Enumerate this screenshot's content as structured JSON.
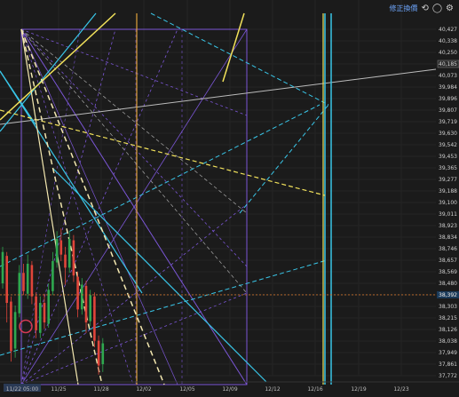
{
  "toolbar": {
    "label": "修正換價",
    "undo_icon": "undo-icon",
    "redo_icon": "redo-icon",
    "settings_icon": "settings-icon"
  },
  "colors": {
    "background": "#1b1b1b",
    "up_candle": "#2fa84f",
    "down_candle": "#e0453a",
    "tool_purple": "#7b56d6",
    "tool_cyan": "#39c6e8",
    "tool_yellow": "#f1e15b",
    "tool_pale_yellow": "#f4e8b0",
    "tool_orange": "#e0a33a",
    "tool_white": "#bbbbbb",
    "current_price_line": "#c7702e",
    "current_price_tag": "#1a3a5a",
    "marker_red": "#d53a55"
  },
  "chart_data": {
    "type": "candlestick",
    "x_axis": {
      "labels": [
        "11/22 05:00",
        "11/25",
        "11/28",
        "12/02",
        "12/05",
        "12/09",
        "12/12",
        "12/16",
        "12/19",
        "12/23"
      ]
    },
    "y_axis": {
      "tick_labels": [
        "40,427",
        "40,338",
        "40,250",
        "40,185",
        "40,073",
        "39,984",
        "39,896",
        "39,807",
        "39,719",
        "39,630",
        "39,542",
        "39,453",
        "39,365",
        "39,277",
        "39,188",
        "39,100",
        "39,011",
        "38,923",
        "38,834",
        "38,746",
        "38,657",
        "38,569",
        "38,480",
        "38,392",
        "38,303",
        "38,215",
        "38,126",
        "38,038",
        "37,949",
        "37,861",
        "37,772"
      ],
      "range": [
        37772,
        40427
      ],
      "highlight_label": "40,185",
      "current_price_label": "38,392"
    },
    "current_price": 38392,
    "candles": [
      {
        "o": 38480,
        "c": 38720,
        "h": 38760,
        "l": 38440
      },
      {
        "o": 38690,
        "c": 38330,
        "h": 38720,
        "l": 38180
      },
      {
        "o": 38340,
        "c": 37960,
        "h": 38380,
        "l": 37880
      },
      {
        "o": 37980,
        "c": 38260,
        "h": 38310,
        "l": 37910
      },
      {
        "o": 38250,
        "c": 38560,
        "h": 38620,
        "l": 38220
      },
      {
        "o": 38560,
        "c": 38420,
        "h": 38630,
        "l": 38390
      },
      {
        "o": 38400,
        "c": 38630,
        "h": 38700,
        "l": 38360
      },
      {
        "o": 38620,
        "c": 38380,
        "h": 38650,
        "l": 38320
      },
      {
        "o": 38380,
        "c": 38120,
        "h": 38410,
        "l": 38060
      },
      {
        "o": 38100,
        "c": 38330,
        "h": 38380,
        "l": 38060
      },
      {
        "o": 38330,
        "c": 38180,
        "h": 38400,
        "l": 38130
      },
      {
        "o": 38170,
        "c": 38430,
        "h": 38480,
        "l": 38140
      },
      {
        "o": 38420,
        "c": 38650,
        "h": 38720,
        "l": 38390
      },
      {
        "o": 38640,
        "c": 38820,
        "h": 38880,
        "l": 38600
      },
      {
        "o": 38810,
        "c": 38700,
        "h": 38900,
        "l": 38650
      },
      {
        "o": 38700,
        "c": 38600,
        "h": 38760,
        "l": 38470
      },
      {
        "o": 38600,
        "c": 38820,
        "h": 38880,
        "l": 38560
      },
      {
        "o": 38810,
        "c": 38540,
        "h": 38850,
        "l": 38490
      },
      {
        "o": 38530,
        "c": 38280,
        "h": 38570,
        "l": 38220
      },
      {
        "o": 38280,
        "c": 38470,
        "h": 38520,
        "l": 38240
      },
      {
        "o": 38460,
        "c": 38180,
        "h": 38500,
        "l": 38100
      },
      {
        "o": 38190,
        "c": 38390,
        "h": 38430,
        "l": 38150
      },
      {
        "o": 38380,
        "c": 38040,
        "h": 38410,
        "l": 37990
      },
      {
        "o": 38040,
        "c": 37850,
        "h": 38080,
        "l": 37780
      },
      {
        "o": 37860,
        "c": 38020,
        "h": 38060,
        "l": 37800
      }
    ],
    "drawing_tools": [
      "fibonacci fan",
      "trend lines",
      "vertical lines",
      "rectangle",
      "marker circle"
    ]
  }
}
